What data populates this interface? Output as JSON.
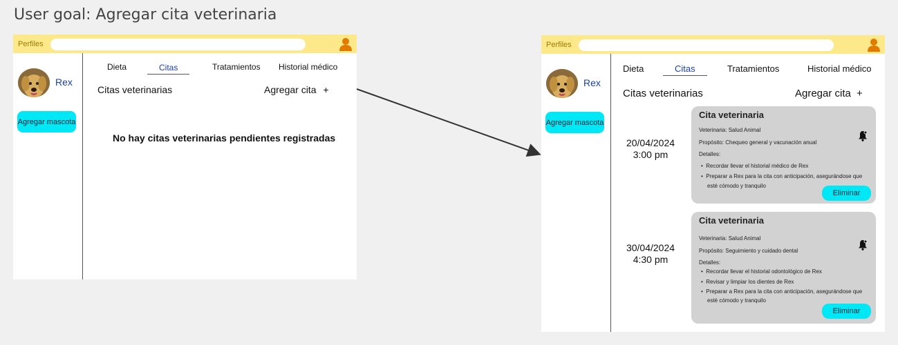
{
  "goal": "User goal: Agregar cita veterinaria",
  "topbar": {
    "brand": "Perfiles",
    "search_placeholder": "",
    "user_icon": "user-icon"
  },
  "sidebar": {
    "pet_name": "Rex",
    "add_pet_label": "Agregar mascota"
  },
  "tabs": [
    "Dieta",
    "Citas",
    "Tratamientos",
    "Historial médico"
  ],
  "active_tab": "Citas",
  "section": {
    "title": "Citas veterinarias",
    "add_label": "Agregar cita",
    "add_icon": "+"
  },
  "empty_message": "No hay citas veterinarias pendientes registradas",
  "appointments": [
    {
      "date": "20/04/2024",
      "time": "3:00 pm",
      "title": "Cita veterinaria",
      "clinic": "Veterinaria: Salud Animal",
      "purpose": "Propósito: Chequeo general y vacunación anual",
      "details_label": "Detalles:",
      "details": [
        "Recordar llevar el historial médico de Rex",
        "Preparar a Rex para la cita con anticipación, asegurándose que",
        "esté cómodo y tranquilo"
      ],
      "delete_label": "Eliminar"
    },
    {
      "date": "30/04/2024",
      "time": "4:30 pm",
      "title": "Cita veterinaria",
      "clinic": "Veterinaria: Salud Animal",
      "purpose": "Propósito: Seguimiento y cuidado dental",
      "details_label": "Detalles:",
      "details": [
        "Recordar llevar el historial odontológico de Rex",
        "Revisar y limpiar los dientes de Rex",
        "Preparar a Rex para la cita con anticipación, asegurándose que",
        "esté cómodo y tranquilo"
      ],
      "delete_label": "Eliminar"
    }
  ],
  "colors": {
    "topbar": "#fde98a",
    "accent": "#00e7f5",
    "link": "#1a3fa8",
    "card": "#d2d2d2"
  }
}
